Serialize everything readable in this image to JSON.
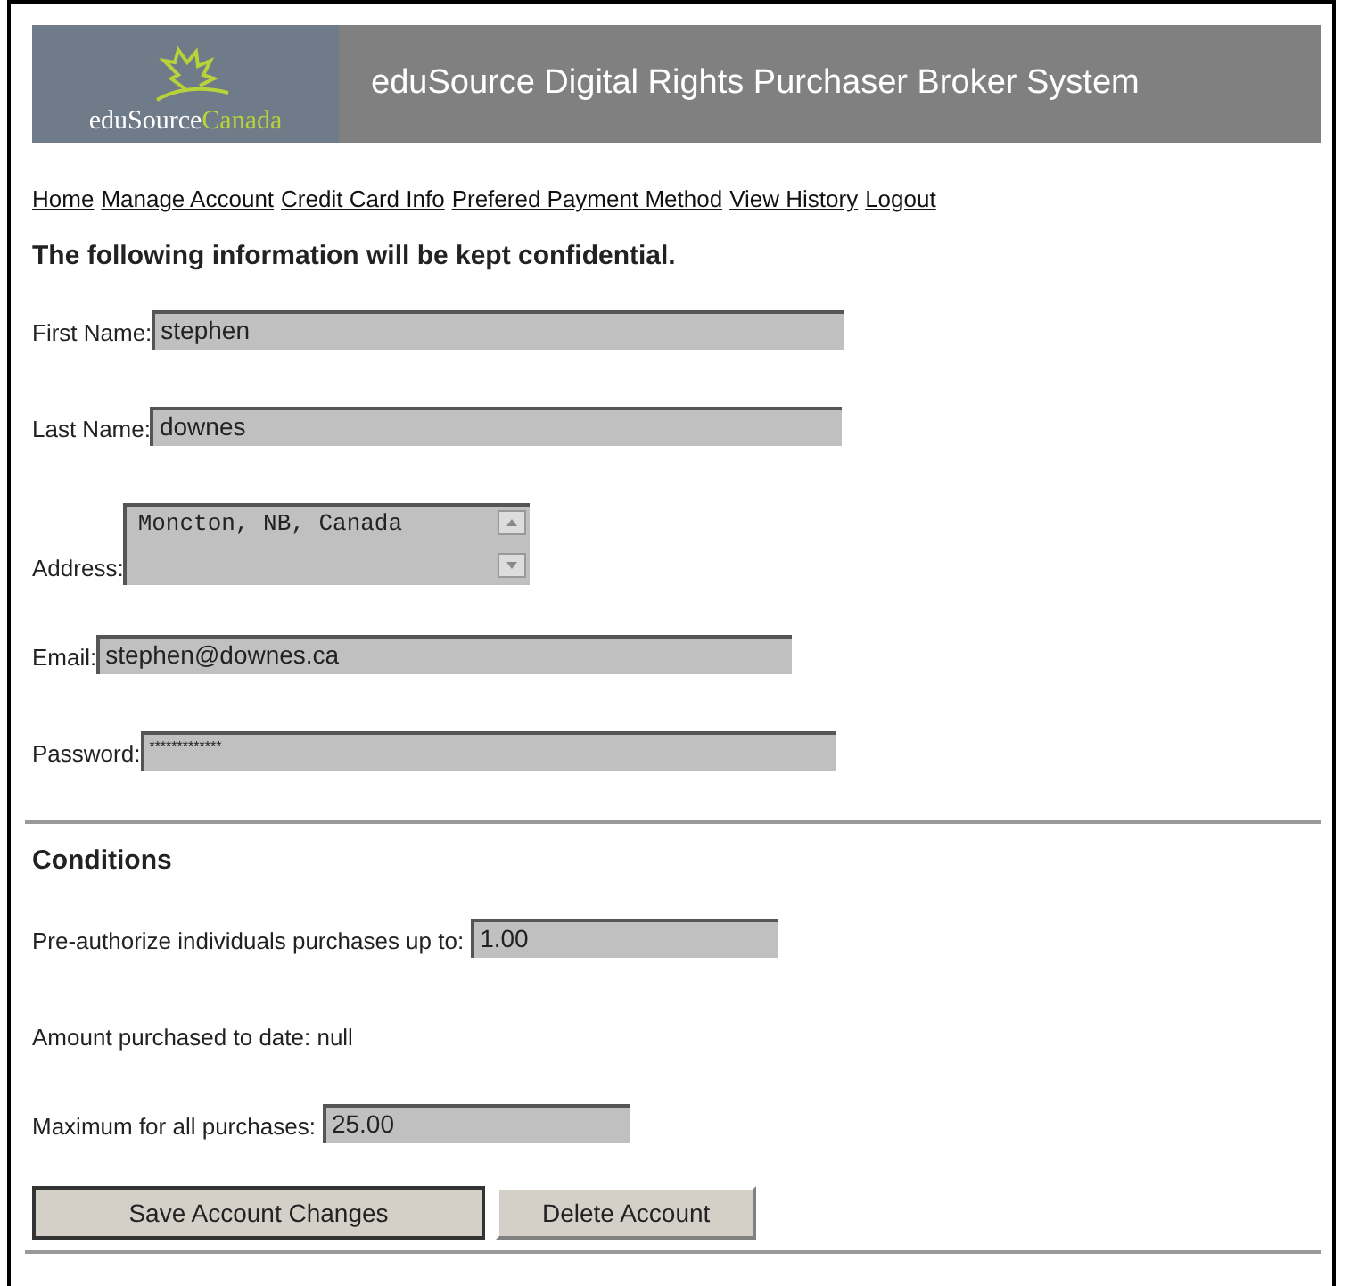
{
  "header": {
    "logo_text": "eduSource",
    "logo_text_accent": "Canada",
    "title": "eduSource Digital Rights Purchaser Broker System"
  },
  "nav": [
    "Home",
    "Manage Account",
    "Credit Card Info",
    "Prefered Payment Method",
    "View History",
    "Logout"
  ],
  "heading": "The following information will be kept confidential.",
  "fields": [
    {
      "kind": "text",
      "label": "First Name:",
      "value": "stephen"
    },
    {
      "kind": "text",
      "label": "Last Name:",
      "value": "downes"
    },
    {
      "kind": "textarea",
      "label": "Address:",
      "value": "Moncton, NB, Canada"
    },
    {
      "kind": "text",
      "label": "Email:",
      "value": "stephen@downes.ca"
    },
    {
      "kind": "password",
      "label": "Password:",
      "value": "*************"
    }
  ],
  "conditions": {
    "title": "Conditions",
    "items": [
      {
        "kind": "input",
        "label": "Pre-authorize individuals purchases up to:",
        "value": "1.00"
      },
      {
        "kind": "text",
        "label": "Amount purchased to date: null"
      },
      {
        "kind": "input",
        "label": "Maximum for all purchases:",
        "value": "25.00"
      }
    ]
  },
  "buttons": [
    {
      "label": "Save Account Changes",
      "default": true
    },
    {
      "label": "Delete Account",
      "default": false
    }
  ]
}
